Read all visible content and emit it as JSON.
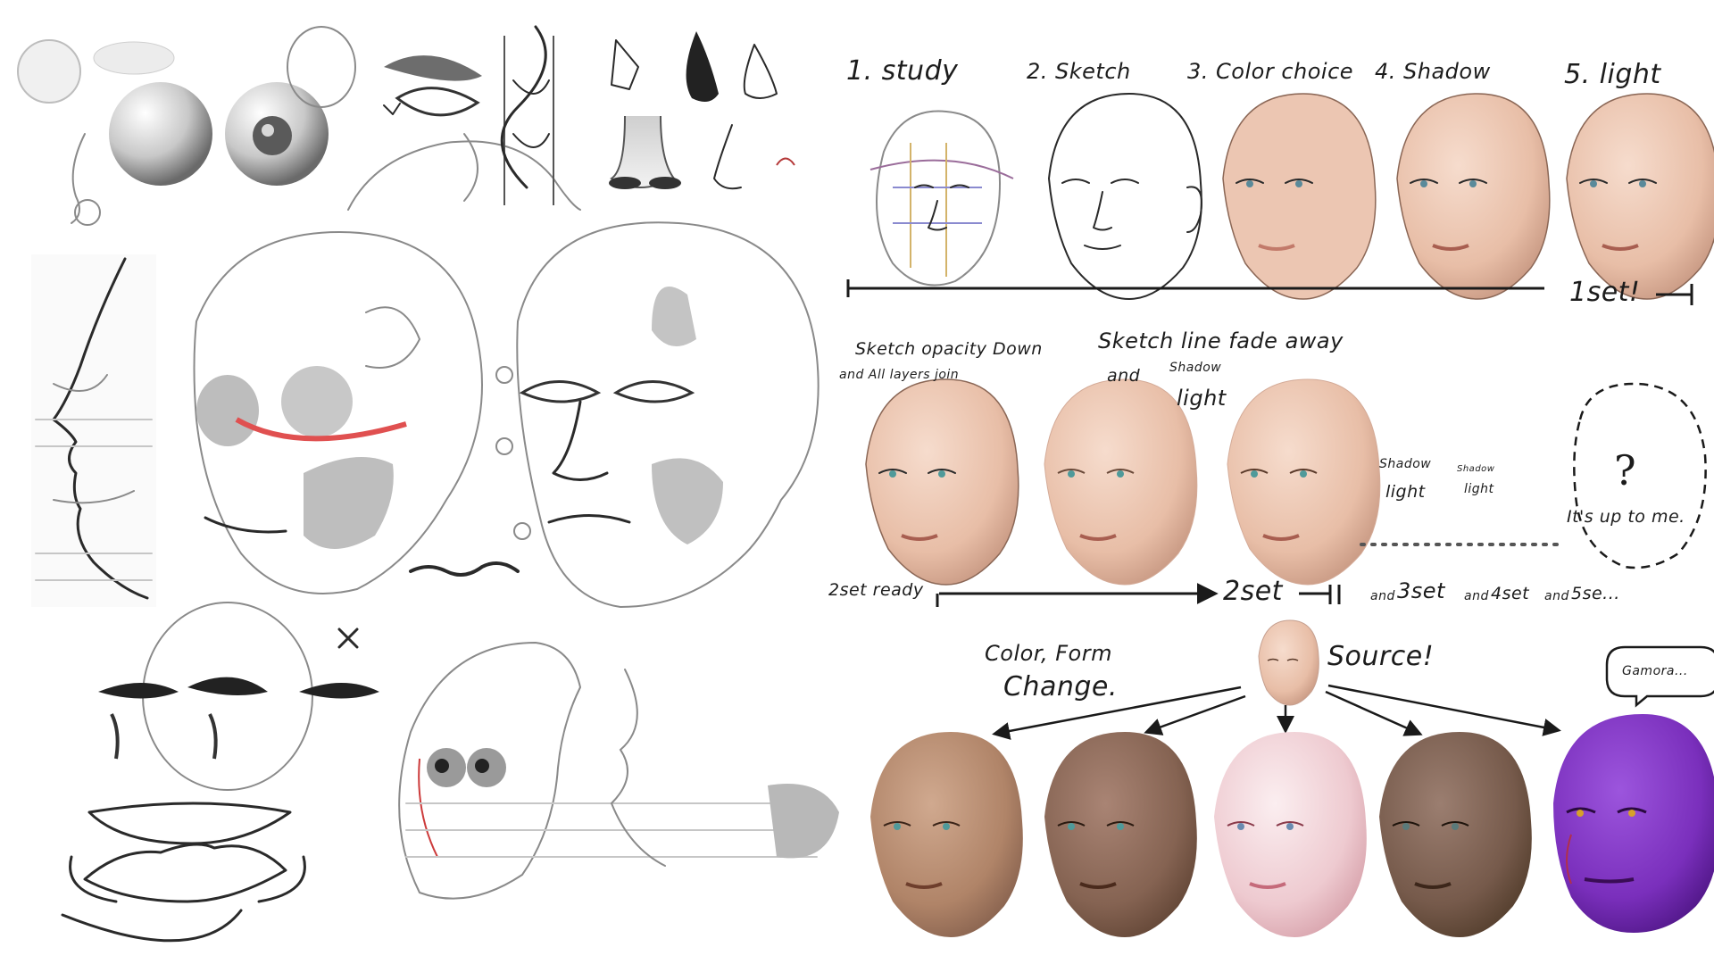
{
  "steps": {
    "s1": "1. study",
    "s2": "2. Sketch",
    "s3": "3. Color choice",
    "s4": "4. Shadow",
    "s5": "5. light",
    "one_set": "1set!"
  },
  "middle": {
    "opacity_line1": "Sketch opacity Down",
    "opacity_line2": "and   All layers join",
    "fade_line": "Sketch line fade away",
    "fade_and": "and",
    "shadow": "Shadow",
    "light": "light",
    "question": "?",
    "up_to_me": "It's up to me.",
    "two_set_ready": "2set ready",
    "two_set": "2set",
    "and_1": "and",
    "three_set": "3set",
    "and_2": "and",
    "four_set": "4set",
    "and_3": "and",
    "five_set": "5se..."
  },
  "bottom": {
    "color_form_1": "Color, Form",
    "color_form_2": "Change.",
    "source": "Source!",
    "gamora": "Gamora..."
  },
  "colors": {
    "skin_base": "#ecc6b2",
    "skin_tan": "#b98d72",
    "skin_brown": "#8f6a57",
    "skin_pink": "#f3d3d9",
    "skin_dark": "#7a5e50",
    "skin_purple": "#7c2fbd",
    "ink": "#1c1c1c"
  }
}
